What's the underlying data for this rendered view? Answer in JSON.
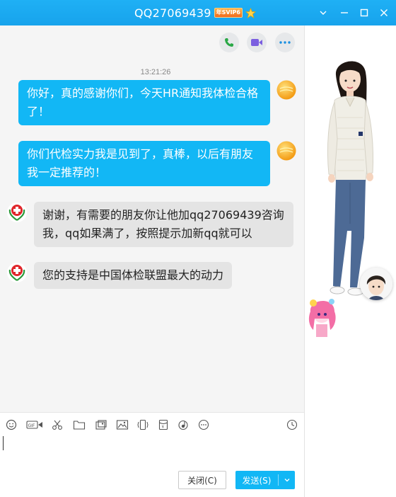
{
  "window": {
    "title": "QQ27069439",
    "vip_badge": "年SVIP6",
    "controls": [
      "chevron-down-icon",
      "minimize-icon",
      "maximize-icon",
      "close-icon"
    ]
  },
  "top_actions": [
    "phone-icon",
    "video-icon",
    "more-icon"
  ],
  "chat": {
    "timestamp": "13:21:26",
    "messages": [
      {
        "from": "me",
        "text": "你好，真的感谢你们，今天HR通知我体检合格了！"
      },
      {
        "from": "me",
        "text": "你们代检实力我是见到了，真棒，以后有朋友我一定推荐的！"
      },
      {
        "from": "them",
        "text": "谢谢，有需要的朋友你让他加qq27069439咨询我，qq如果满了，按照提示加新qq就可以"
      },
      {
        "from": "them",
        "text": "您的支持是中国体检联盟最大的动力"
      }
    ]
  },
  "toolbar": {
    "icons": [
      "emoji-icon",
      "gif-icon",
      "scissors-icon",
      "folder-icon",
      "screenshot-icon",
      "image-icon",
      "shake-icon",
      "red-packet-icon",
      "music-icon",
      "more-icon",
      "history-clock-icon"
    ]
  },
  "buttons": {
    "close_label": "关闭(C)",
    "send_label": "发送(S)"
  },
  "colors": {
    "titlebar": "#17a3ec",
    "my_bubble": "#12b7f5",
    "their_bubble": "#e4e4e4",
    "send_button": "#12b7f5"
  }
}
